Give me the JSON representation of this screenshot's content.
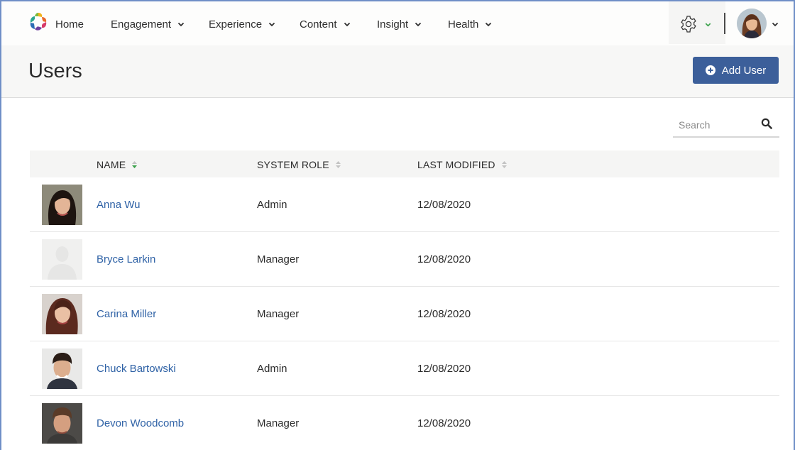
{
  "nav": {
    "items": [
      {
        "label": "Home",
        "has_menu": false
      },
      {
        "label": "Engagement",
        "has_menu": true
      },
      {
        "label": "Experience",
        "has_menu": true
      },
      {
        "label": "Content",
        "has_menu": true
      },
      {
        "label": "Insight",
        "has_menu": true
      },
      {
        "label": "Health",
        "has_menu": true
      }
    ],
    "settings_icon": "gear-icon",
    "accent_color": "#3aa14a"
  },
  "page": {
    "title": "Users",
    "add_button_label": "Add User",
    "button_color": "#3c5f9a"
  },
  "search": {
    "placeholder": "Search"
  },
  "table": {
    "columns": [
      {
        "label": "NAME",
        "sorted": true
      },
      {
        "label": "SYSTEM ROLE",
        "sorted": false
      },
      {
        "label": "LAST MODIFIED",
        "sorted": false
      }
    ],
    "rows": [
      {
        "name": "Anna Wu",
        "role": "Admin",
        "last_modified": "12/08/2020",
        "photo": "photo"
      },
      {
        "name": "Bryce Larkin",
        "role": "Manager",
        "last_modified": "12/08/2020",
        "photo": "placeholder"
      },
      {
        "name": "Carina Miller",
        "role": "Manager",
        "last_modified": "12/08/2020",
        "photo": "photo"
      },
      {
        "name": "Chuck Bartowski",
        "role": "Admin",
        "last_modified": "12/08/2020",
        "photo": "photo"
      },
      {
        "name": "Devon Woodcomb",
        "role": "Manager",
        "last_modified": "12/08/2020",
        "photo": "photo"
      }
    ],
    "link_color": "#2f62a6"
  }
}
